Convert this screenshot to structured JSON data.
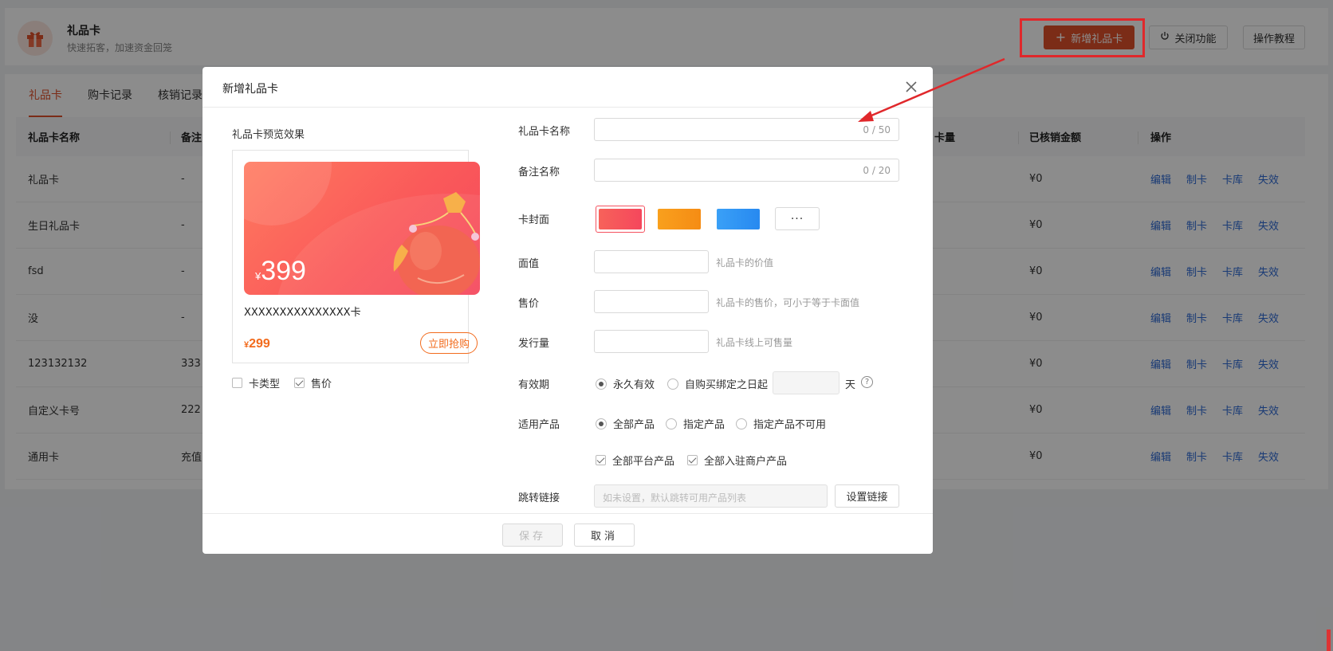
{
  "app": {
    "title": "礼品卡",
    "subtitle": "快速拓客，加速资金回笼",
    "icon": "gift-icon"
  },
  "header_buttons": {
    "add": "新增礼品卡",
    "add_icon": "plus-icon",
    "close_feature": "关闭功能",
    "close_icon": "power-icon",
    "tutorial": "操作教程"
  },
  "tabs": [
    "礼品卡",
    "购卡记录",
    "核销记录"
  ],
  "table": {
    "headers": {
      "name": "礼品卡名称",
      "note": "备注",
      "qty": "卡量",
      "amount": "已核销金额",
      "ops": "操作"
    },
    "rows": [
      {
        "name": "礼品卡",
        "note": "-",
        "amount": "¥0"
      },
      {
        "name": "生日礼品卡",
        "note": "-",
        "amount": "¥0"
      },
      {
        "name": "fsd",
        "note": "-",
        "amount": "¥0"
      },
      {
        "name": "没",
        "note": "-",
        "amount": "¥0"
      },
      {
        "name": "123132132",
        "note": "333",
        "amount": "¥0"
      },
      {
        "name": "自定义卡号",
        "note": "222",
        "amount": "¥0"
      },
      {
        "name": "通用卡",
        "note": "充值",
        "amount": "¥0"
      }
    ],
    "ops": [
      "编辑",
      "制卡",
      "卡库",
      "失效"
    ]
  },
  "modal": {
    "title": "新增礼品卡",
    "preview": {
      "label": "礼品卡预览效果",
      "card_currency": "¥",
      "card_value": "399",
      "card_name": "XXXXXXXXXXXXXXX卡",
      "sale_currency": "¥",
      "sale_price": "299",
      "buy_button": "立即抢购",
      "check_card_type": "卡类型",
      "check_price": "售价"
    },
    "form": {
      "name_label": "礼品卡名称",
      "name_counter": "0 / 50",
      "note_label": "备注名称",
      "note_counter": "0 / 20",
      "cover_label": "卡封面",
      "cover_more": "···",
      "face_label": "面值",
      "face_hint": "礼品卡的价值",
      "sale_label": "售价",
      "sale_hint": "礼品卡的售价，可小于等于卡面值",
      "issue_label": "发行量",
      "issue_hint": "礼品卡线上可售量",
      "validity_label": "有效期",
      "validity_forever": "永久有效",
      "validity_from": "自购买绑定之日起",
      "validity_days": "天",
      "products_label": "适用产品",
      "products_all": "全部产品",
      "products_specified": "指定产品",
      "products_excluded": "指定产品不可用",
      "products_platform": "全部平台产品",
      "products_merchant": "全部入驻商户产品",
      "jump_label": "跳转链接",
      "jump_placeholder": "如未设置，默认跳转可用产品列表",
      "jump_button": "设置链接"
    },
    "footer": {
      "save": "保存",
      "cancel": "取消"
    }
  },
  "colors": {
    "accent": "#e0512b",
    "link": "#2f6bd6",
    "cover_red": "#f5515f",
    "cover_orange": "#f7941d",
    "cover_blue": "#2f94f5",
    "annotation": "#e0282b"
  }
}
